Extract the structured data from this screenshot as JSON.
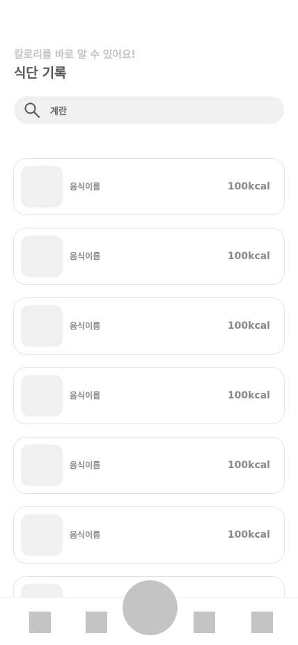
{
  "header": {
    "subtitle": "칼로리를 바로 알 수 있어요!",
    "title": "식단 기록"
  },
  "search": {
    "icon": "search-icon",
    "value": "계란"
  },
  "foods": [
    {
      "name": "음식이름",
      "kcal": "100kcal"
    },
    {
      "name": "음식이름",
      "kcal": "100kcal"
    },
    {
      "name": "음식이름",
      "kcal": "100kcal"
    },
    {
      "name": "음식이름",
      "kcal": "100kcal"
    },
    {
      "name": "음식이름",
      "kcal": "100kcal"
    },
    {
      "name": "음식이름",
      "kcal": "100kcal"
    },
    {
      "name": "",
      "kcal": ""
    }
  ],
  "colors": {
    "placeholder_gray": "#c4c4c4",
    "surface_gray": "#f0f0f0",
    "text_gray": "#8a8a8a",
    "title_gray": "#555555"
  }
}
